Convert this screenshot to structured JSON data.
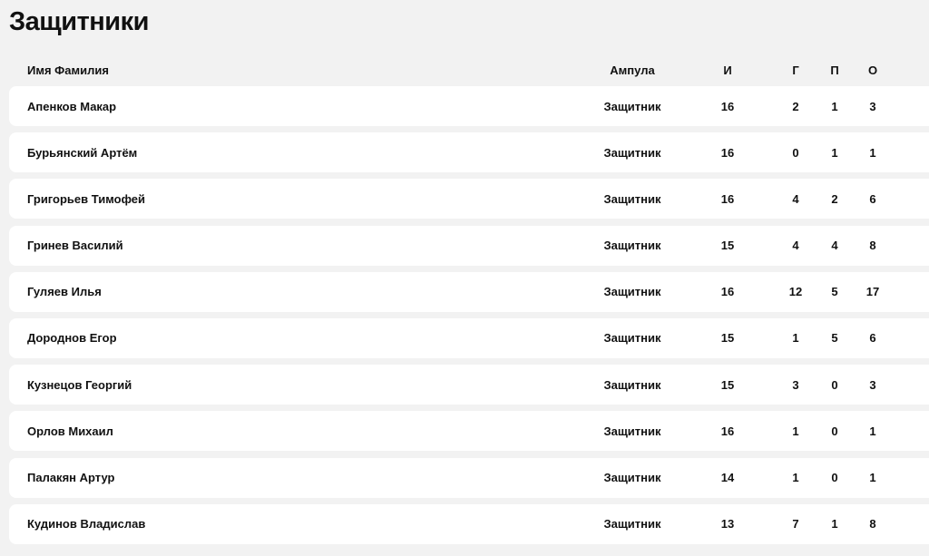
{
  "page": {
    "title": "Защитники"
  },
  "table": {
    "headers": {
      "name": "Имя Фамилия",
      "role": "Ампула",
      "games": "И",
      "goals": "Г",
      "assists": "П",
      "points": "О"
    },
    "rows": [
      {
        "name": "Апенков Макар",
        "role": "Защитник",
        "games": "16",
        "goals": "2",
        "assists": "1",
        "points": "3"
      },
      {
        "name": "Бурьянский Артём",
        "role": "Защитник",
        "games": "16",
        "goals": "0",
        "assists": "1",
        "points": "1"
      },
      {
        "name": "Григорьев Тимофей",
        "role": "Защитник",
        "games": "16",
        "goals": "4",
        "assists": "2",
        "points": "6"
      },
      {
        "name": "Гринев Василий",
        "role": "Защитник",
        "games": "15",
        "goals": "4",
        "assists": "4",
        "points": "8"
      },
      {
        "name": "Гуляев Илья",
        "role": "Защитник",
        "games": "16",
        "goals": "12",
        "assists": "5",
        "points": "17"
      },
      {
        "name": "Дороднов Егор",
        "role": "Защитник",
        "games": "15",
        "goals": "1",
        "assists": "5",
        "points": "6"
      },
      {
        "name": "Кузнецов Георгий",
        "role": "Защитник",
        "games": "15",
        "goals": "3",
        "assists": "0",
        "points": "3"
      },
      {
        "name": "Орлов Михаил",
        "role": "Защитник",
        "games": "16",
        "goals": "1",
        "assists": "0",
        "points": "1"
      },
      {
        "name": "Палакян Артур",
        "role": "Защитник",
        "games": "14",
        "goals": "1",
        "assists": "0",
        "points": "1"
      },
      {
        "name": "Кудинов Владислав",
        "role": "Защитник",
        "games": "13",
        "goals": "7",
        "assists": "1",
        "points": "8"
      }
    ]
  }
}
